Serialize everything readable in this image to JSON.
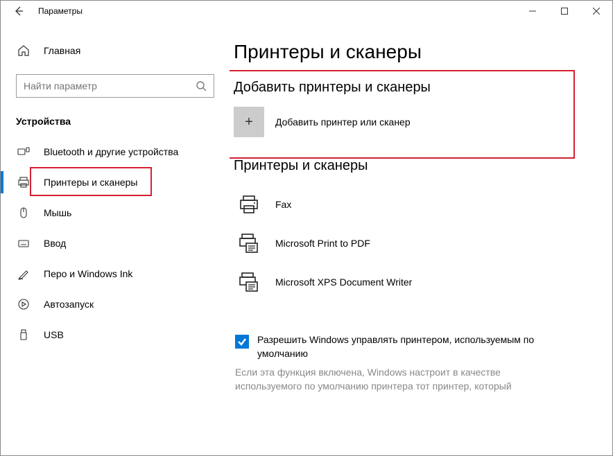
{
  "window": {
    "title": "Параметры"
  },
  "sidebar": {
    "home": "Главная",
    "search_placeholder": "Найти параметр",
    "group": "Устройства",
    "items": [
      {
        "label": "Bluetooth и другие устройства"
      },
      {
        "label": "Принтеры и сканеры"
      },
      {
        "label": "Мышь"
      },
      {
        "label": "Ввод"
      },
      {
        "label": "Перо и Windows Ink"
      },
      {
        "label": "Автозапуск"
      },
      {
        "label": "USB"
      }
    ]
  },
  "page": {
    "title": "Принтеры и сканеры",
    "add_section": "Добавить принтеры и сканеры",
    "add_label": "Добавить принтер или сканер",
    "list_section": "Принтеры и сканеры",
    "printers": [
      {
        "label": "Fax"
      },
      {
        "label": "Microsoft Print to PDF"
      },
      {
        "label": "Microsoft XPS Document Writer"
      }
    ],
    "checkbox_label": "Разрешить Windows управлять принтером, используемым по умолчанию",
    "hint": "Если эта функция включена, Windows настроит в качестве используемого по умолчанию принтера тот принтер, который"
  }
}
